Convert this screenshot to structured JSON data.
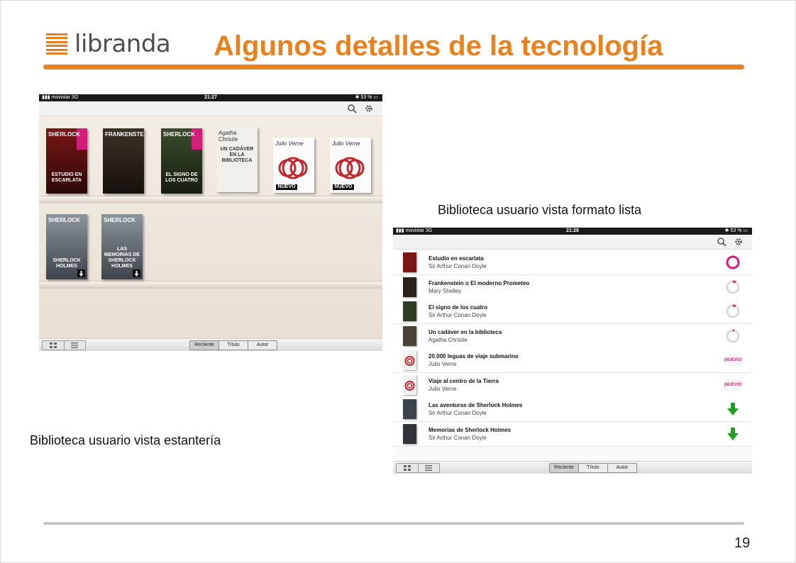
{
  "header": {
    "logo_text": "libranda",
    "title": "Algunos detalles de la tecnología",
    "accent_color": "#e8821e"
  },
  "captions": {
    "list_view": "Biblioteca usuario vista formato lista",
    "shelf_view": "Biblioteca usuario vista estantería"
  },
  "page_number": "19",
  "shelf_device": {
    "status": {
      "carrier": "movistar",
      "network": "3G",
      "time": "21:27",
      "battery": "53 %"
    },
    "toolbar_icons": [
      "search-icon",
      "gear-icon"
    ],
    "books": [
      {
        "name": "estudio-en-escarlata",
        "title": "SHERLOCK",
        "subtitle": "ESTUDIO EN ESCARLATA",
        "style": "red",
        "status": "partial"
      },
      {
        "name": "frankenstein",
        "title": "FRANKENSTEIN",
        "subtitle": "",
        "style": "dark",
        "status": "partial"
      },
      {
        "name": "el-signo-de-los-cuatro",
        "title": "SHERLOCK",
        "subtitle": "EL SIGNO DE LOS CUATRO",
        "style": "green",
        "status": "partial"
      },
      {
        "name": "un-cadaver",
        "title": "Agatha Christie",
        "subtitle": "UN CADÁVER EN LA BIBLIOTECA",
        "style": "agatha",
        "status": "partial"
      },
      {
        "name": "veinte-mil-leguas",
        "title": "Julio Verne",
        "subtitle": "NUEVO",
        "style": "verne",
        "status": "new"
      },
      {
        "name": "viaje-al-centro",
        "title": "Julio Verne",
        "subtitle": "NUEVO",
        "style": "verne",
        "status": "new"
      },
      {
        "name": "aventuras-sherlock",
        "title": "SHERLOCK",
        "subtitle": "SHERLOCK HOLMES",
        "style": "sherl",
        "status": "download"
      },
      {
        "name": "memorias-sherlock",
        "title": "SHERLOCK",
        "subtitle": "LAS MEMORIAS DE SHERLOCK HOLMES",
        "style": "sherl",
        "status": "download"
      }
    ],
    "sort_tabs": [
      "Reciente",
      "Título",
      "Autor"
    ],
    "selected_sort": "Reciente"
  },
  "list_device": {
    "status": {
      "carrier": "movistar",
      "network": "3G",
      "time": "21:28",
      "battery": "53 %"
    },
    "toolbar_icons": [
      "search-icon",
      "gear-icon"
    ],
    "rows": [
      {
        "title": "Estudio en escarlata",
        "author": "Sir Arthur Conan Doyle",
        "status": "progress",
        "progress": 1.0,
        "thumb": "#7a1616"
      },
      {
        "title": "Frankenstein o El moderno Prometeo",
        "author": "Mary Shelley",
        "status": "progress",
        "progress": 0.08,
        "thumb": "#2a241b"
      },
      {
        "title": "El signo de los cuatro",
        "author": "Sir Arthur Conan Doyle",
        "status": "progress",
        "progress": 0.08,
        "thumb": "#2f3d24"
      },
      {
        "title": "Un cadáver en la biblioteca",
        "author": "Agatha Christie",
        "status": "progress",
        "progress": 0.04,
        "thumb": "#4a4236"
      },
      {
        "title": "20.000 leguas de viaje submarino",
        "author": "Julio Verne",
        "status": "new",
        "badge": "¡NUEVO!",
        "thumb": "#f2f2f2"
      },
      {
        "title": "Viaje al centro de la Tierra",
        "author": "Julio Verne",
        "status": "new",
        "badge": "¡NUEVO!",
        "thumb": "#f2f2f2"
      },
      {
        "title": "Las aventuras de Sherlock Holmes",
        "author": "Sir Arthur Conan Doyle",
        "status": "download",
        "thumb": "#3c434a"
      },
      {
        "title": "Memorias de Sherlock Holmes",
        "author": "Sir Arthur Conan Doyle",
        "status": "download",
        "thumb": "#2e343a"
      }
    ],
    "sort_tabs": [
      "Reciente",
      "Título",
      "Autor"
    ],
    "selected_sort": "Reciente"
  },
  "colors": {
    "magenta": "#d21d7a",
    "download_green": "#22a022",
    "progress_track": "#d9d9d9"
  }
}
